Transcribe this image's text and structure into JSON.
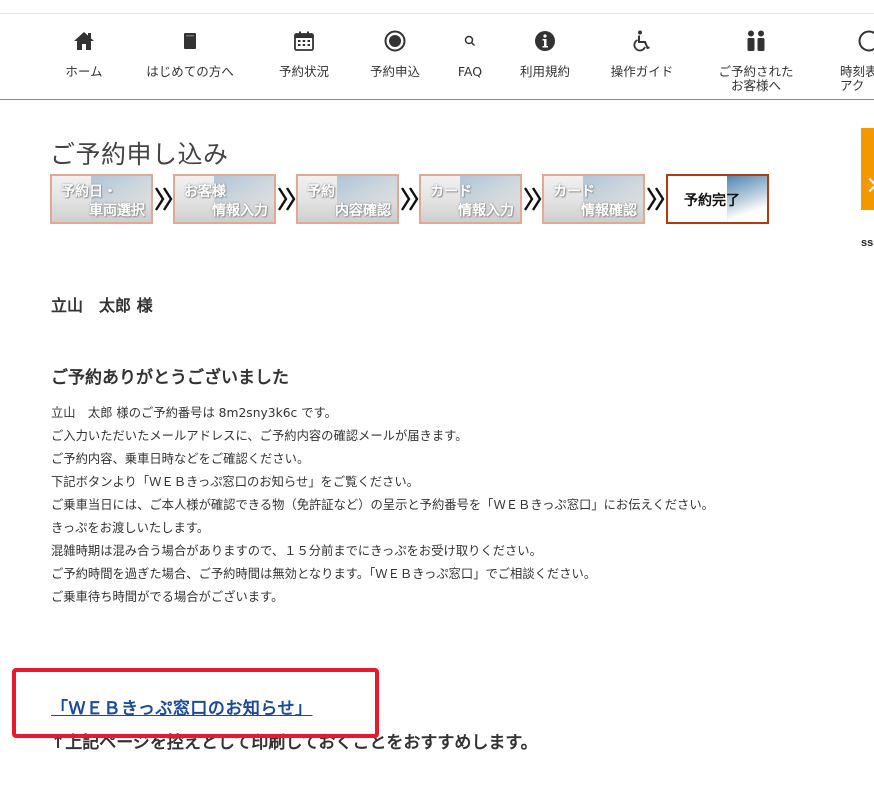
{
  "nav": {
    "items": [
      {
        "label": "ホーム",
        "icon": "home-icon"
      },
      {
        "label": "はじめての方へ",
        "icon": "book-icon"
      },
      {
        "label": "予約状況",
        "icon": "calendar-icon"
      },
      {
        "label": "予約申込",
        "icon": "circle-dot-icon"
      },
      {
        "label": "FAQ",
        "icon": "search-icon"
      },
      {
        "label": "利用規約",
        "icon": "info-icon"
      },
      {
        "label": "操作ガイド",
        "icon": "wheelchair-icon"
      },
      {
        "label": "ご予約された\nお客様へ",
        "icon": "people-icon"
      },
      {
        "label": "時刻表\nアク",
        "icon": "clock-icon"
      }
    ]
  },
  "page": {
    "title": "ご予約申し込み"
  },
  "steps": [
    {
      "line1": "予約日・",
      "line2": "車両選択",
      "active": false
    },
    {
      "line1": "お客様",
      "line2": "情報入力",
      "active": false
    },
    {
      "line1": "予約",
      "line2": "内容確認",
      "active": false
    },
    {
      "line1": "カード",
      "line2": "情報入力",
      "active": false
    },
    {
      "line1": "カード",
      "line2": "情報確認",
      "active": false
    },
    {
      "line1": "予約完了",
      "line2": "",
      "active": true
    }
  ],
  "sidebar": {
    "text": "ss"
  },
  "content": {
    "customer_name": "立山　太郎 様",
    "thanks_heading": "ご予約ありがとうございました",
    "lines": [
      "立山　太郎 様のご予約番号は 8m2sny3k6c です。",
      "ご入力いただいたメールアドレスに、ご予約内容の確認メールが届きます。",
      "ご予約内容、乗車日時などをご確認ください。",
      "下記ボタンより「ＷＥＢきっぷ窓口のお知らせ」をご覧ください。",
      "ご乗車当日には、ご本人様が確認できる物（免許証など）の呈示と予約番号を「ＷＥＢきっぷ窓口」にお伝えください。",
      "きっぷをお渡しいたします。",
      "混雑時期は混み合う場合がありますので、１５分前までにきっぷをお受け取りください。",
      "ご予約時間を過ぎた場合、ご予約時間は無効となります。「ＷＥＢきっぷ窓口」でご相談ください。",
      "ご乗車待ち時間がでる場合がございます。"
    ],
    "web_link": "「ＷＥＢきっぷ窓口のお知らせ」",
    "note": "↑上記ページを控えとして印刷しておくことをおすすめします。"
  },
  "colors": {
    "highlight": "#e8192c",
    "link": "#1a4a9c",
    "accent": "#f39800",
    "active_step_border": "#b23a0e"
  }
}
